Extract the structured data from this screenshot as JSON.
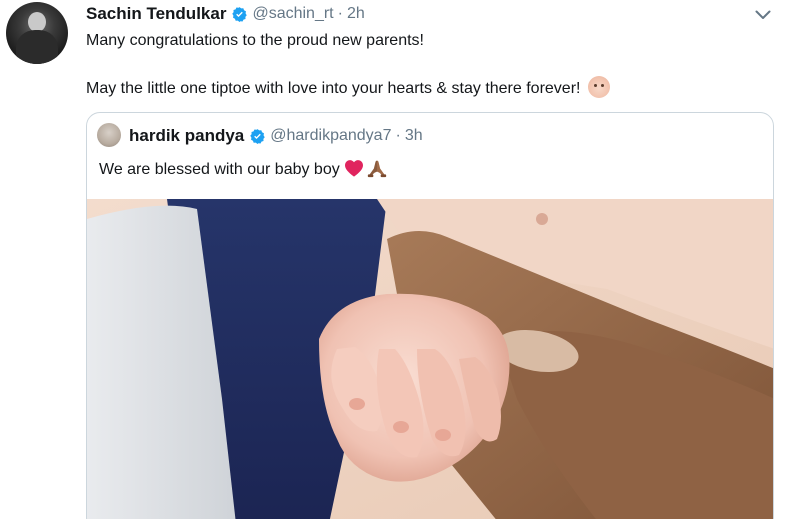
{
  "tweet": {
    "author": {
      "display_name": "Sachin Tendulkar",
      "handle": "@sachin_rt",
      "separator": "·",
      "time": "2h",
      "verified": true
    },
    "text_lines": [
      "Many congratulations to the proud new parents!",
      "May the little one tiptoe with love into your hearts & stay there forever!"
    ],
    "trailing_emoji": "baby-face",
    "menu_icon": "chevron-down-icon"
  },
  "quoted_tweet": {
    "author": {
      "display_name": "hardik pandya",
      "handle": "@hardikpandya7",
      "separator": "·",
      "time": "3h",
      "verified": true
    },
    "text": "We are blessed with our baby boy",
    "emojis": [
      "red-heart",
      "folded-hands"
    ],
    "media": {
      "type": "photo",
      "subject": "baby-hand-holding-finger"
    }
  },
  "colors": {
    "text_primary": "#14171a",
    "text_secondary": "#657786",
    "verified_blue": "#1da1f2",
    "border": "#ccd6dd",
    "heart_red": "#e0245e"
  }
}
